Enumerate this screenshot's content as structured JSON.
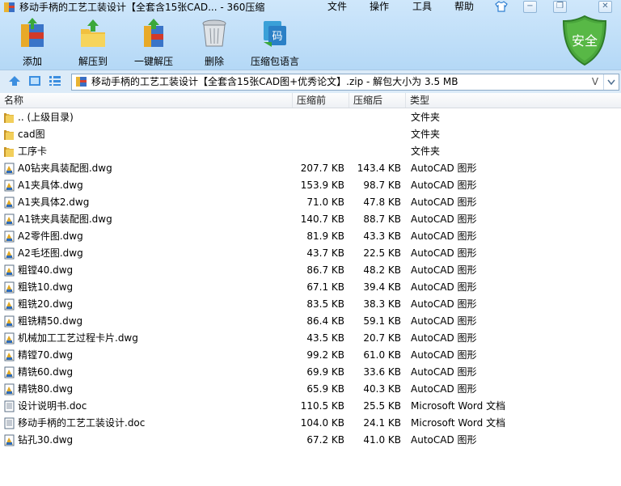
{
  "window": {
    "title": "移动手柄的工艺工装设计【全套含15张CAD... - 360压缩",
    "menu": [
      "文件",
      "操作",
      "工具",
      "帮助"
    ],
    "window_buttons": [
      "shirt-icon",
      "minimize",
      "restore",
      "close"
    ]
  },
  "toolbar": {
    "items": [
      {
        "label": "添加",
        "icon": "add-archive-icon"
      },
      {
        "label": "解压到",
        "icon": "extract-to-icon"
      },
      {
        "label": "一键解压",
        "icon": "one-click-extract-icon"
      },
      {
        "label": "删除",
        "icon": "delete-trash-icon"
      },
      {
        "label": "压缩包语言",
        "icon": "archive-language-icon"
      }
    ],
    "badge": "安全",
    "icon_text": "码"
  },
  "addressbar": {
    "path": "移动手柄的工艺工装设计【全套含15张CAD图+优秀论文】.zip - 解包大小为 3.5 MB",
    "v_label": "V"
  },
  "columns": {
    "name": "名称",
    "size": "压缩前",
    "compressed": "压缩后",
    "type": "类型"
  },
  "files": [
    {
      "name": ".. (上级目录)",
      "size": "",
      "compressed": "",
      "type": "文件夹",
      "kind": "folder"
    },
    {
      "name": "cad图",
      "size": "",
      "compressed": "",
      "type": "文件夹",
      "kind": "folder"
    },
    {
      "name": "工序卡",
      "size": "",
      "compressed": "",
      "type": "文件夹",
      "kind": "folder"
    },
    {
      "name": "A0钻夹具装配图.dwg",
      "size": "207.7 KB",
      "compressed": "143.4 KB",
      "type": "AutoCAD 图形",
      "kind": "dwg"
    },
    {
      "name": "A1夹具体.dwg",
      "size": "153.9 KB",
      "compressed": "98.7 KB",
      "type": "AutoCAD 图形",
      "kind": "dwg"
    },
    {
      "name": "A1夹具体2.dwg",
      "size": "71.0 KB",
      "compressed": "47.8 KB",
      "type": "AutoCAD 图形",
      "kind": "dwg"
    },
    {
      "name": "A1铣夹具装配图.dwg",
      "size": "140.7 KB",
      "compressed": "88.7 KB",
      "type": "AutoCAD 图形",
      "kind": "dwg"
    },
    {
      "name": "A2零件图.dwg",
      "size": "81.9 KB",
      "compressed": "43.3 KB",
      "type": "AutoCAD 图形",
      "kind": "dwg"
    },
    {
      "name": "A2毛坯图.dwg",
      "size": "43.7 KB",
      "compressed": "22.5 KB",
      "type": "AutoCAD 图形",
      "kind": "dwg"
    },
    {
      "name": "粗镗40.dwg",
      "size": "86.7 KB",
      "compressed": "48.2 KB",
      "type": "AutoCAD 图形",
      "kind": "dwg"
    },
    {
      "name": "粗铣10.dwg",
      "size": "67.1 KB",
      "compressed": "39.4 KB",
      "type": "AutoCAD 图形",
      "kind": "dwg"
    },
    {
      "name": "粗铣20.dwg",
      "size": "83.5 KB",
      "compressed": "38.3 KB",
      "type": "AutoCAD 图形",
      "kind": "dwg"
    },
    {
      "name": "粗铣精50.dwg",
      "size": "86.4 KB",
      "compressed": "59.1 KB",
      "type": "AutoCAD 图形",
      "kind": "dwg"
    },
    {
      "name": "机械加工工艺过程卡片.dwg",
      "size": "43.5 KB",
      "compressed": "20.7 KB",
      "type": "AutoCAD 图形",
      "kind": "dwg"
    },
    {
      "name": "精镗70.dwg",
      "size": "99.2 KB",
      "compressed": "61.0 KB",
      "type": "AutoCAD 图形",
      "kind": "dwg"
    },
    {
      "name": "精铣60.dwg",
      "size": "69.9 KB",
      "compressed": "33.6 KB",
      "type": "AutoCAD 图形",
      "kind": "dwg"
    },
    {
      "name": "精铣80.dwg",
      "size": "65.9 KB",
      "compressed": "40.3 KB",
      "type": "AutoCAD 图形",
      "kind": "dwg"
    },
    {
      "name": "设计说明书.doc",
      "size": "110.5 KB",
      "compressed": "25.5 KB",
      "type": "Microsoft Word 文档",
      "kind": "doc"
    },
    {
      "name": "移动手柄的工艺工装设计.doc",
      "size": "104.0 KB",
      "compressed": "24.1 KB",
      "type": "Microsoft Word 文档",
      "kind": "doc"
    },
    {
      "name": "钻孔30.dwg",
      "size": "67.2 KB",
      "compressed": "41.0 KB",
      "type": "AutoCAD 图形",
      "kind": "dwg"
    }
  ]
}
